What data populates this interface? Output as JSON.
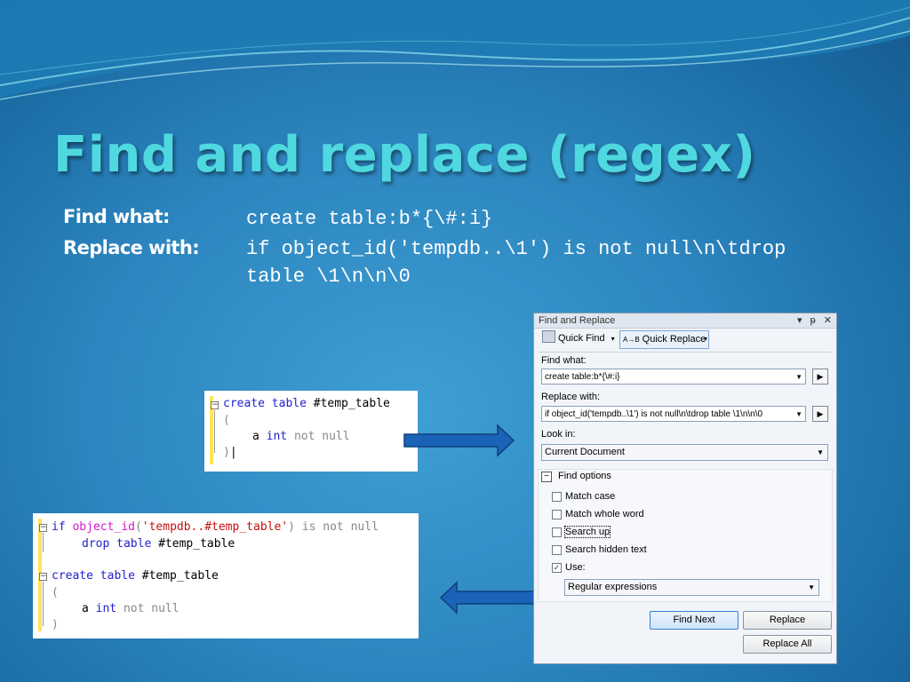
{
  "slide": {
    "title": "Find and replace (regex)",
    "find_label": "Find what:",
    "find_value": "create table:b*{\\#:i}",
    "replace_label": "Replace with:",
    "replace_value_line1": "if object_id('tempdb..\\1') is not null\\n\\tdrop",
    "replace_value_line2": "table \\1\\n\\n\\0"
  },
  "snippet_before": {
    "line1_kw": "create table",
    "line1_name": " #temp_table",
    "line2": "(",
    "line3_col": "a",
    "line3_type": "int",
    "line3_rest": "not null",
    "line4": ")"
  },
  "snippet_after": {
    "l1_kw": "if",
    "l1_fn": "object_id",
    "l1_open": "(",
    "l1_str": "'tempdb..#temp_table'",
    "l1_close": ")",
    "l1_rest": "is not null",
    "l2_kw": "drop table",
    "l2_name": " #temp_table",
    "l3_kw": "create table",
    "l3_name": " #temp_table",
    "l4": "(",
    "l5_col": "a",
    "l5_type": "int",
    "l5_rest": "not null",
    "l6": ")"
  },
  "dialog": {
    "title": "Find and Replace",
    "controls": [
      "▾",
      "ᵽ",
      "✕"
    ],
    "quick_find": "Quick Find",
    "quick_replace": "Quick Replace",
    "find_what_label": "Find what:",
    "find_what_value": "create table:b*{\\#:i}",
    "replace_with_label": "Replace with:",
    "replace_with_value": "if object_id('tempdb..\\1') is not null\\n\\tdrop table \\1\\n\\n\\0",
    "look_in_label": "Look in:",
    "look_in_value": "Current Document",
    "find_options_label": "Find options",
    "options": [
      {
        "label": "Match case",
        "checked": false
      },
      {
        "label": "Match whole word",
        "checked": false
      },
      {
        "label": "Search up",
        "checked": false
      },
      {
        "label": "Search hidden text",
        "checked": false
      },
      {
        "label": "Use:",
        "checked": true
      }
    ],
    "use_value": "Regular expressions",
    "find_next": "Find Next",
    "replace": "Replace",
    "replace_all": "Replace All"
  },
  "colors": {
    "title": "#4fd8e0",
    "arrow_fill": "#1a63b8",
    "keyword": "#2222cc",
    "function": "#d417c9",
    "string": "#c41010"
  }
}
